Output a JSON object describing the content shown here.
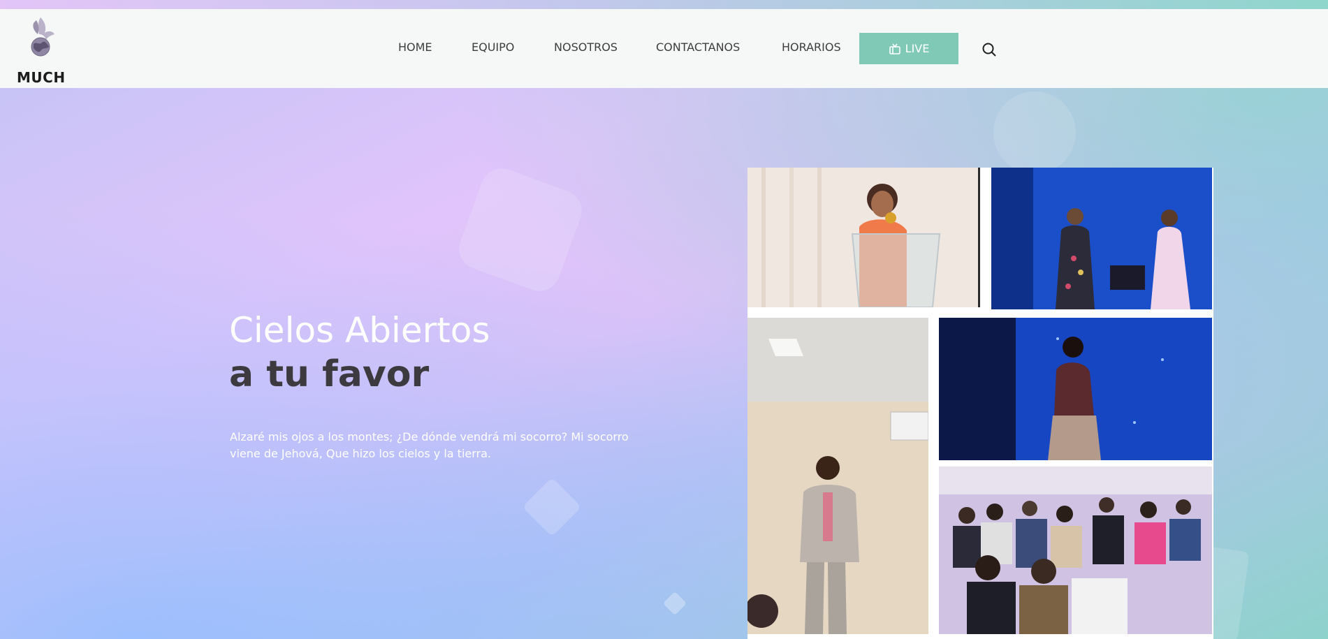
{
  "brand": {
    "name": "MUCH",
    "logo_icon": "dove-globe-icon"
  },
  "nav": {
    "items": [
      {
        "label": "HOME"
      },
      {
        "label": "EQUIPO"
      },
      {
        "label": "NOSOTROS"
      },
      {
        "label": "CONTACTANOS"
      },
      {
        "label": "HORARIOS"
      }
    ],
    "live_label": "LIVE",
    "live_icon": "tv-icon",
    "search_icon": "search-icon"
  },
  "hero": {
    "title_light": "Cielos Abiertos",
    "title_bold": "a tu favor",
    "text": "Alzaré mis ojos a los montes; ¿De dónde vendrá mi socorro? Mi socorro viene de Jehová, Que hizo los cielos y la tierra."
  },
  "gallery": {
    "photos": [
      {
        "subject": "woman-preaching-at-podium"
      },
      {
        "subject": "two-girls-singing-on-stage"
      },
      {
        "subject": "man-speaking-with-microphone"
      },
      {
        "subject": "woman-singing-on-blue-stage"
      },
      {
        "subject": "congregation-seated"
      }
    ]
  },
  "colors": {
    "accent": "#80c9b6",
    "nav_bg": "#f6f8f7",
    "title_dark": "#3c3a3e"
  }
}
